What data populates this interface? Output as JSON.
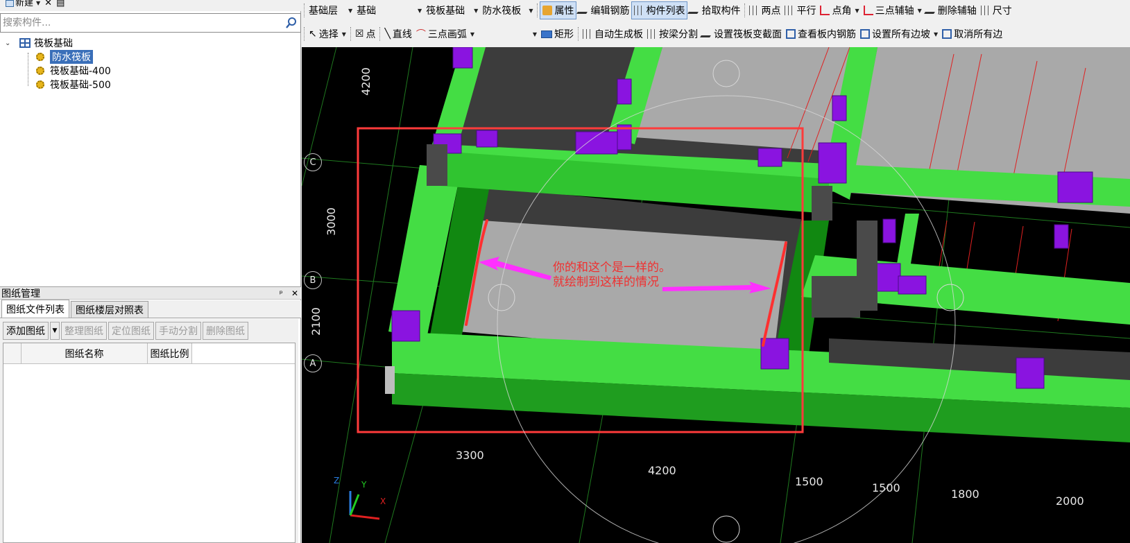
{
  "left_panel": {
    "mini_toolbar": {
      "new_label": "新建",
      "delete_label": "✕",
      "copy_label": "▤"
    },
    "search": {
      "placeholder": "搜索构件..."
    },
    "tree": {
      "root_label": "筏板基础",
      "children": [
        {
          "label": "防水筏板",
          "selected": true
        },
        {
          "label": "筏板基础-400",
          "selected": false
        },
        {
          "label": "筏板基础-500",
          "selected": false
        }
      ]
    },
    "drawing_manager": {
      "title": "图纸管理",
      "pin": "📌",
      "close": "✕",
      "tabs": [
        "图纸文件列表",
        "图纸楼层对照表"
      ],
      "buttons": {
        "add": "添加图纸",
        "organize": "整理图纸",
        "locate": "定位图纸",
        "split": "手动分割",
        "delete": "删除图纸"
      },
      "columns": {
        "name": "图纸名称",
        "scale": "图纸比例"
      }
    }
  },
  "toolbar_row1": {
    "floor": "基础层",
    "category": "基础",
    "type": "筏板基础",
    "component": "防水筏板",
    "property": "属性",
    "edit_rebar": "编辑钢筋",
    "component_list": "构件列表",
    "pick_component": "拾取构件",
    "two_points": "两点",
    "parallel": "平行",
    "point_angle": "点角",
    "three_point_axis": "三点辅轴",
    "delete_axis": "删除辅轴",
    "dimension": "尺寸"
  },
  "toolbar_row2": {
    "select": "选择",
    "point": "点",
    "line": "直线",
    "arc": "三点画弧",
    "rect": "矩形",
    "auto_gen": "自动生成板",
    "split_by_beam": "按梁分割",
    "set_slope_section": "设置筏板变截面",
    "view_rebar": "查看板内钢筋",
    "set_all_slope": "设置所有边坡",
    "cancel_all_edge": "取消所有边"
  },
  "viewport": {
    "dims_left": [
      "4200",
      "3000",
      "2100"
    ],
    "dims_bottom": [
      "3300",
      "4200",
      "1500",
      "1500",
      "1800",
      "2000"
    ],
    "axes": [
      "C",
      "B",
      "A"
    ],
    "annotation_line1": "你的和这个是一样的。",
    "annotation_line2": "就绘制到这样的情况",
    "axis_labels": {
      "x": "X",
      "y": "Y",
      "z": "Z"
    },
    "colors": {
      "beam_green": "#44dd44",
      "slab_gray": "#a8a8a8",
      "column_purple": "#8a14e0",
      "highlight_red": "#ff3b3b"
    }
  }
}
